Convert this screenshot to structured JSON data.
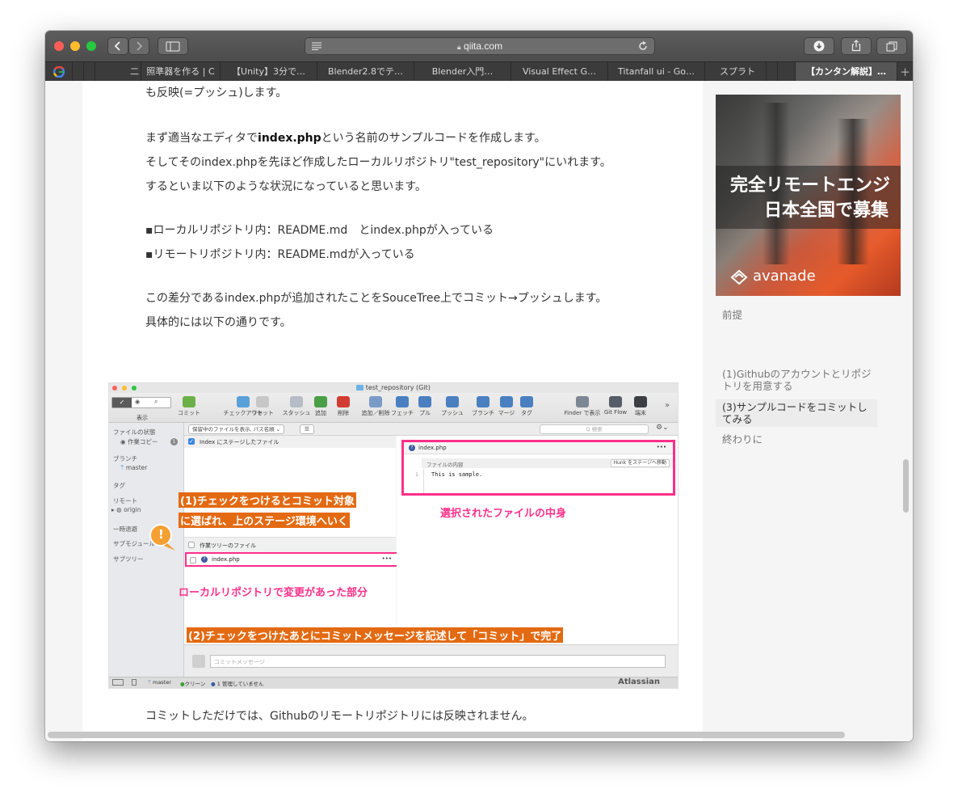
{
  "browser": {
    "url": "qiita.com",
    "tabs": [
      "二",
      "照準器を作る | C",
      "【Unity】3分で…",
      "Blender2.8でテ…",
      "Blender入門…",
      "Visual Effect G…",
      "Titanfall ui - Go…",
      "スプラト",
      "【カンタン解説】…"
    ],
    "new_tab": "+"
  },
  "article": {
    "line1": "も反映(=プッシュ)します。",
    "line2_pre": "まず適当なエディタで",
    "line2_bold": "index.php",
    "line2_post": "という名前のサンプルコードを作成します。",
    "line3": "そしてそのindex.phpを先ほど作成したローカルリポジトリ\"test_repository\"にいれます。",
    "line4": "するといま以下のような状況になっていると思います。",
    "line5": "▪ローカルリポジトリ内：README.md　とindex.phpが入っている",
    "line6": "▪リモートリポジトリ内：README.mdが入っている",
    "line7": "この差分であるindex.phpが追加されたことをSouceTree上でコミット→プッシュします。",
    "line8": "具体的には以下の通りです。",
    "line9": "コミットしただけでは、Githubのリモートリポジトリには反映されません。"
  },
  "ad": {
    "line1": "完全リモートエンジ",
    "line2": "日本全国で募集",
    "brand": "avanade"
  },
  "toc": [
    {
      "label": "前提",
      "active": false
    },
    {
      "label": "(1)Githubのアカウントとリポジトリを用意する",
      "active": false
    },
    {
      "label": "(3)サンプルコードをコミットしてみる",
      "active": true
    },
    {
      "label": "終わりに",
      "active": false
    }
  ],
  "sourcetree": {
    "window_title": "test_repository (Git)",
    "toolbar": [
      {
        "label": "表示",
        "color": "#cfcfcf"
      },
      {
        "label": "コミット",
        "color": "#6cb04a"
      },
      {
        "label": "チェックアウト",
        "color": "#5aa0d8"
      },
      {
        "label": "リセット",
        "color": "#c7c7c7"
      },
      {
        "label": "スタッシュ",
        "color": "#b6bdc6"
      },
      {
        "label": "追加",
        "color": "#4a9e45"
      },
      {
        "label": "削除",
        "color": "#d23d33"
      },
      {
        "label": "追加／削除",
        "color": "#7a9bc6"
      },
      {
        "label": "フェッチ",
        "color": "#4a7fc0"
      },
      {
        "label": "プル",
        "color": "#4a7fc0"
      },
      {
        "label": "プッシュ",
        "color": "#4a7fc0"
      },
      {
        "label": "ブランチ",
        "color": "#4a7fc0"
      },
      {
        "label": "マージ",
        "color": "#4a7fc0"
      },
      {
        "label": "タグ",
        "color": "#4a7fc0"
      },
      {
        "label": "Finder で表示",
        "color": "#7c8794"
      },
      {
        "label": "Git Flow",
        "color": "#555d66"
      },
      {
        "label": "端末",
        "color": "#3b3f44"
      }
    ],
    "filter_select": "保留中のファイルを表示, パス名順",
    "search_placeholder": "Q 検索",
    "sidebar": {
      "file_status": "ファイルの状態",
      "working_copy": "作業コピー",
      "working_copy_badge": "1",
      "branches": "ブランチ",
      "master": "master",
      "tags": "タグ",
      "remotes": "リモート",
      "origin": "origin",
      "stashes": "一時退避",
      "submodules": "サブモジュール",
      "subtrees": "サブツリー"
    },
    "staged_label": "Index にステージしたファイル",
    "file_name": "index.php",
    "file_content_header": "ファイルの内容",
    "hunk_button": "Hunk をステージへ移動",
    "code_line_no": "1",
    "code_line": "This is sample.",
    "unstaged_label": "作業ツリーのファイル",
    "unstaged_file": "index.php",
    "commit_placeholder": "コミットメッセージ",
    "status_branch": "master",
    "status_clean": "クリーン",
    "status_unmanaged": "1 管理していません",
    "brand": "Atlassian",
    "annotations": {
      "note1": "(1)チェックをつけるとコミット対象",
      "note1b": "に選ばれ、上のステージ環境へいく",
      "note2": "選択されたファイルの中身",
      "note3": "ローカルリポジトリで変更があった部分",
      "note4": "(2)チェックをつけたあとにコミットメッセージを記述して「コミット」で完了",
      "more": "•••",
      "excl": "!"
    }
  }
}
